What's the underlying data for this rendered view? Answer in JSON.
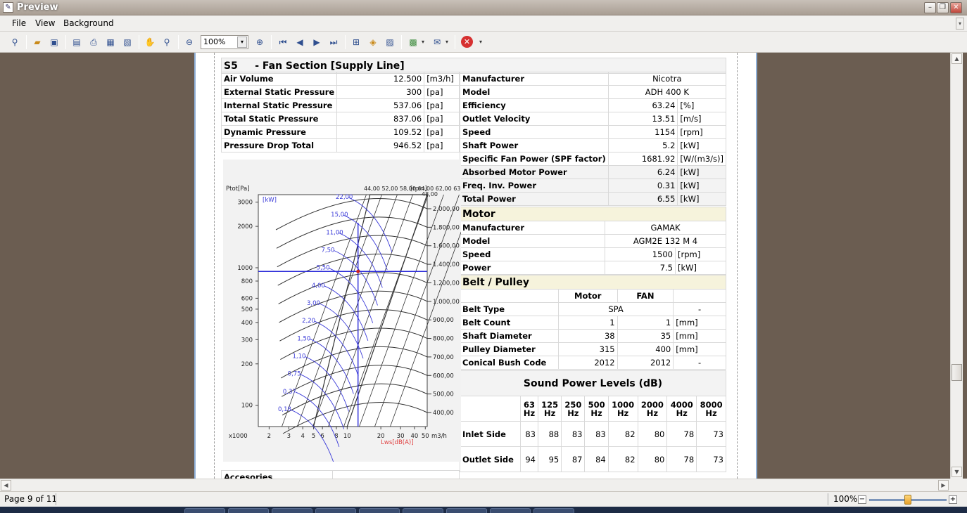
{
  "window": {
    "title": "Preview",
    "icon": "preview-app-icon"
  },
  "menu": {
    "file": "File",
    "view": "View",
    "background": "Background"
  },
  "toolbar": {
    "zoom_value": "100%"
  },
  "report": {
    "section_code": "S5",
    "section_title": "- Fan Section [Supply Line]",
    "left_params": [
      {
        "label": "Air Volume",
        "value": "12.500",
        "unit": "[m3/h]"
      },
      {
        "label": "External Static Pressure",
        "value": "300",
        "unit": "[pa]"
      },
      {
        "label": "Internal Static Pressure",
        "value": "537.06",
        "unit": "[pa]"
      },
      {
        "label": "Total Static Pressure",
        "value": "837.06",
        "unit": "[pa]"
      },
      {
        "label": "Dynamic Pressure",
        "value": "109.52",
        "unit": "[pa]"
      },
      {
        "label": "Pressure Drop Total",
        "value": "946.52",
        "unit": "[pa]"
      }
    ],
    "fan_params": [
      {
        "label": "Manufacturer",
        "value": "Nicotra",
        "unit": ""
      },
      {
        "label": "Model",
        "value": "ADH 400 K",
        "unit": ""
      },
      {
        "label": "Efficiency",
        "value": "63.24",
        "unit": "[%]"
      },
      {
        "label": "Outlet Velocity",
        "value": "13.51",
        "unit": "[m/s]"
      },
      {
        "label": "Speed",
        "value": "1154",
        "unit": "[rpm]"
      },
      {
        "label": "Shaft Power",
        "value": "5.2",
        "unit": "[kW]"
      },
      {
        "label": "Specific Fan Power (SPF factor)",
        "value": "1681.92",
        "unit": "[W/(m3/s)]"
      },
      {
        "label": "Absorbed Motor Power",
        "value": "6.24",
        "unit": "[kW]"
      },
      {
        "label": "Freq. Inv. Power",
        "value": "0.31",
        "unit": "[kW]"
      },
      {
        "label": "Total Power",
        "value": "6.55",
        "unit": "[kW]"
      }
    ],
    "motor": {
      "title": "Motor",
      "rows": [
        {
          "label": "Manufacturer",
          "value": "GAMAK",
          "unit": ""
        },
        {
          "label": "Model",
          "value": "AGM2E 132 M 4",
          "unit": ""
        },
        {
          "label": "Speed",
          "value": "1500",
          "unit": "[rpm]"
        },
        {
          "label": "Power",
          "value": "7.5",
          "unit": "[kW]"
        }
      ]
    },
    "belt": {
      "title": "Belt / Pulley",
      "col_motor": "Motor",
      "col_fan": "FAN",
      "rows": [
        {
          "label": "Belt Type",
          "motor": "SPA",
          "fan": "",
          "unit": "-"
        },
        {
          "label": "Belt Count",
          "motor": "1",
          "fan": "1",
          "unit": "[mm]"
        },
        {
          "label": "Shaft Diameter",
          "motor": "38",
          "fan": "35",
          "unit": "[mm]"
        },
        {
          "label": "Pulley Diameter",
          "motor": "315",
          "fan": "400",
          "unit": "[mm]"
        },
        {
          "label": "Conical Bush Code",
          "motor": "2012",
          "fan": "2012",
          "unit": "-"
        }
      ]
    },
    "sound": {
      "title": "Sound Power Levels (dB)",
      "freqs": [
        "63",
        "125",
        "250",
        "500",
        "1000",
        "2000",
        "4000",
        "8000"
      ],
      "hz": "Hz",
      "inlet_label": "Inlet Side",
      "inlet": [
        "83",
        "88",
        "83",
        "83",
        "82",
        "80",
        "78",
        "73"
      ],
      "outlet_label": "Outlet Side",
      "outlet": [
        "94",
        "95",
        "87",
        "84",
        "82",
        "80",
        "78",
        "73"
      ]
    },
    "accessories_label": "Accesories"
  },
  "fan_chart": {
    "y_title": "Ptot[Pa]",
    "kw_title": "[kW]",
    "rpm_title": "[rpm]",
    "x_unit": "m3/h",
    "x_prefix": "x1000",
    "lws": "Lws[dB(A)]",
    "y_ticks": [
      "3000",
      "2000",
      "1000",
      "800",
      "600",
      "500",
      "400",
      "300",
      "200",
      "100"
    ],
    "x_ticks": [
      "2",
      "3",
      "4",
      "5",
      "6",
      "8",
      "10",
      "20",
      "30",
      "40",
      "50"
    ],
    "kw_labels": [
      "22,00",
      "15,00",
      "11,00",
      "7,50",
      "5,50",
      "4,00",
      "3,00",
      "2,20",
      "1,50",
      "1,10",
      "0,75",
      "0,37",
      "0,18"
    ],
    "rpm_labels": [
      "2.000,00",
      "1.800,00",
      "1.600,00",
      "1.400,00",
      "1.200,00",
      "1.000,00",
      "900,00",
      "800,00",
      "700,00",
      "600,00",
      "500,00",
      "400,00"
    ],
    "top_labels": "44,00 52,00 58,00 64,00 62,00 63,00",
    "corner_value": "48,00"
  },
  "status": {
    "page": "Page 9 of 11",
    "zoom": "100%"
  }
}
